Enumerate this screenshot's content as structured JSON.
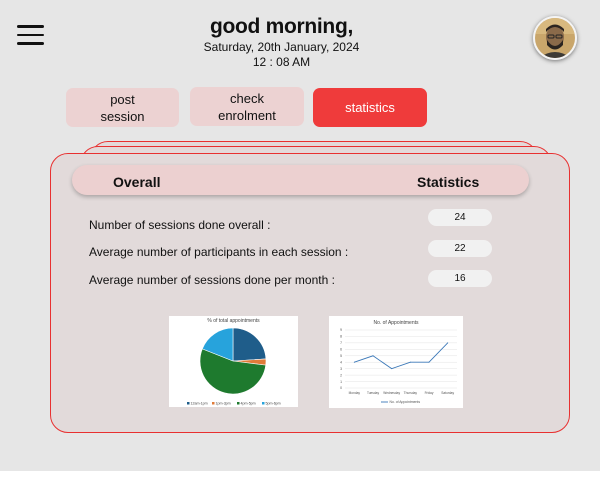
{
  "header": {
    "greeting": "good morning,",
    "date": "Saturday, 20th January, 2024",
    "time": "12 : 08 AM"
  },
  "icons": {
    "menu": "hamburger-menu-icon",
    "avatar": "user-avatar"
  },
  "buttons": {
    "post_session": {
      "line1": "post",
      "line2": "session"
    },
    "check_enrolment": {
      "line1": "check",
      "line2": "enrolment"
    },
    "statistics": "statistics"
  },
  "colors": {
    "accent": "#ef3b3b",
    "button": "#ecd2d2",
    "card": "#e2dada",
    "border": "#e83030"
  },
  "stats": {
    "col_left": "Overall",
    "col_right": "Statistics",
    "rows": [
      {
        "label": "Number of sessions done overall :",
        "value": "24"
      },
      {
        "label": "Average number of participants in each session :",
        "value": "22"
      },
      {
        "label": "Average number of sessions done per month :",
        "value": "16"
      }
    ]
  },
  "chart_data": [
    {
      "type": "pie",
      "title": "% of total appointments",
      "categories": [
        "12am-1pm",
        "1pm-3pm",
        "4pm-5pm",
        "5pm-6pm"
      ],
      "values": [
        24,
        3,
        54,
        19
      ],
      "colors": [
        "#1f5d8a",
        "#e07b39",
        "#1e7a2e",
        "#27a3dc"
      ]
    },
    {
      "type": "line",
      "title": "No. of Appointments",
      "categories": [
        "Monday",
        "Tuesday",
        "Wednesday",
        "Thursday",
        "Friday",
        "Saturday"
      ],
      "series": [
        {
          "name": "No. of Appointments",
          "values": [
            4,
            5,
            3,
            4,
            4,
            7
          ]
        }
      ],
      "ylim": [
        0,
        9
      ],
      "yticks": [
        "0",
        "1",
        "2",
        "3",
        "4",
        "5",
        "6",
        "7",
        "8",
        "9"
      ]
    }
  ]
}
